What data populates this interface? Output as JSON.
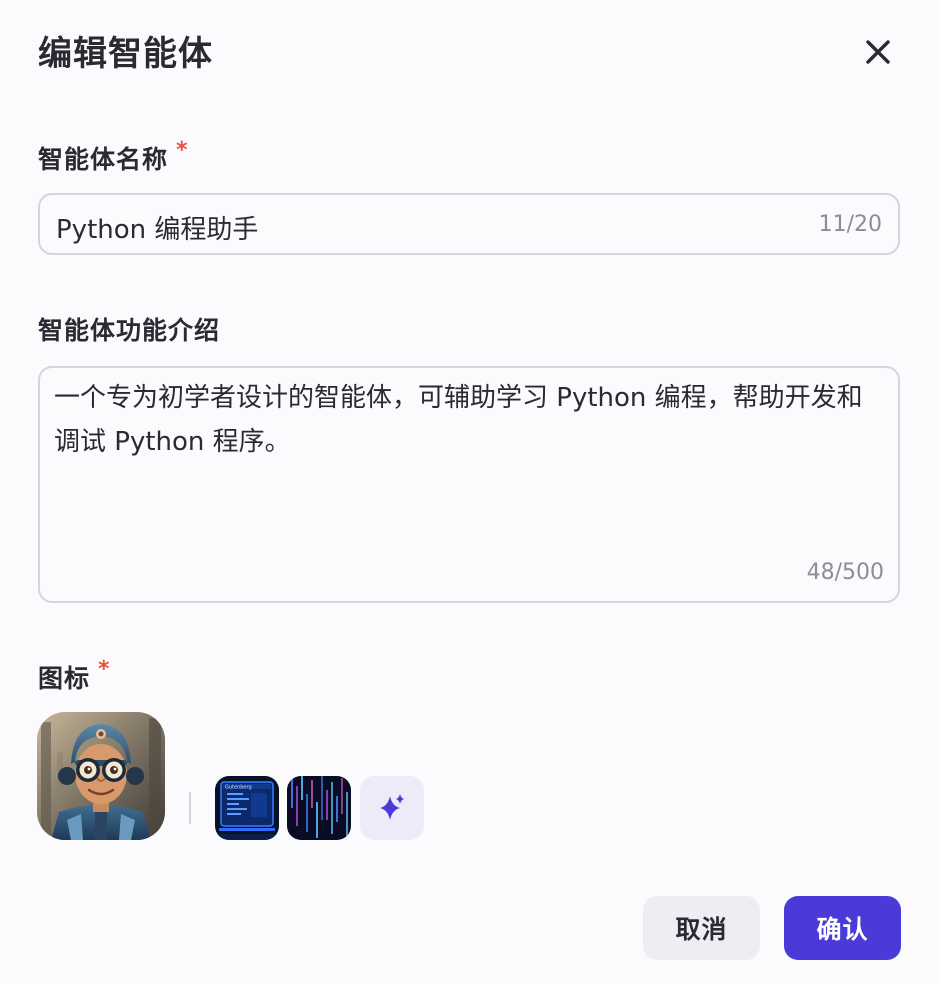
{
  "dialog": {
    "title": "编辑智能体",
    "close_icon": "close-icon"
  },
  "name_field": {
    "label": "智能体名称",
    "required_mark": "*",
    "value": "Python 编程助手",
    "counter": "11/20"
  },
  "description_field": {
    "label": "智能体功能介绍",
    "value": "一个专为初学者设计的智能体，可辅助学习 Python 编程，帮助开发和调试 Python 程序。",
    "counter": "48/500"
  },
  "icon_field": {
    "label": "图标",
    "required_mark": "*",
    "selected_icon": "robot-avatar",
    "options": [
      "computer-screen-thumbnail",
      "matrix-code-thumbnail"
    ],
    "generate_icon": "sparkle-icon",
    "thumb_label": "Gutenberg"
  },
  "footer": {
    "cancel_label": "取消",
    "confirm_label": "确认"
  },
  "colors": {
    "accent": "#4A3BD8",
    "required": "#E5533D",
    "border": "#D6D4DE",
    "background": "#FBFAFD"
  }
}
